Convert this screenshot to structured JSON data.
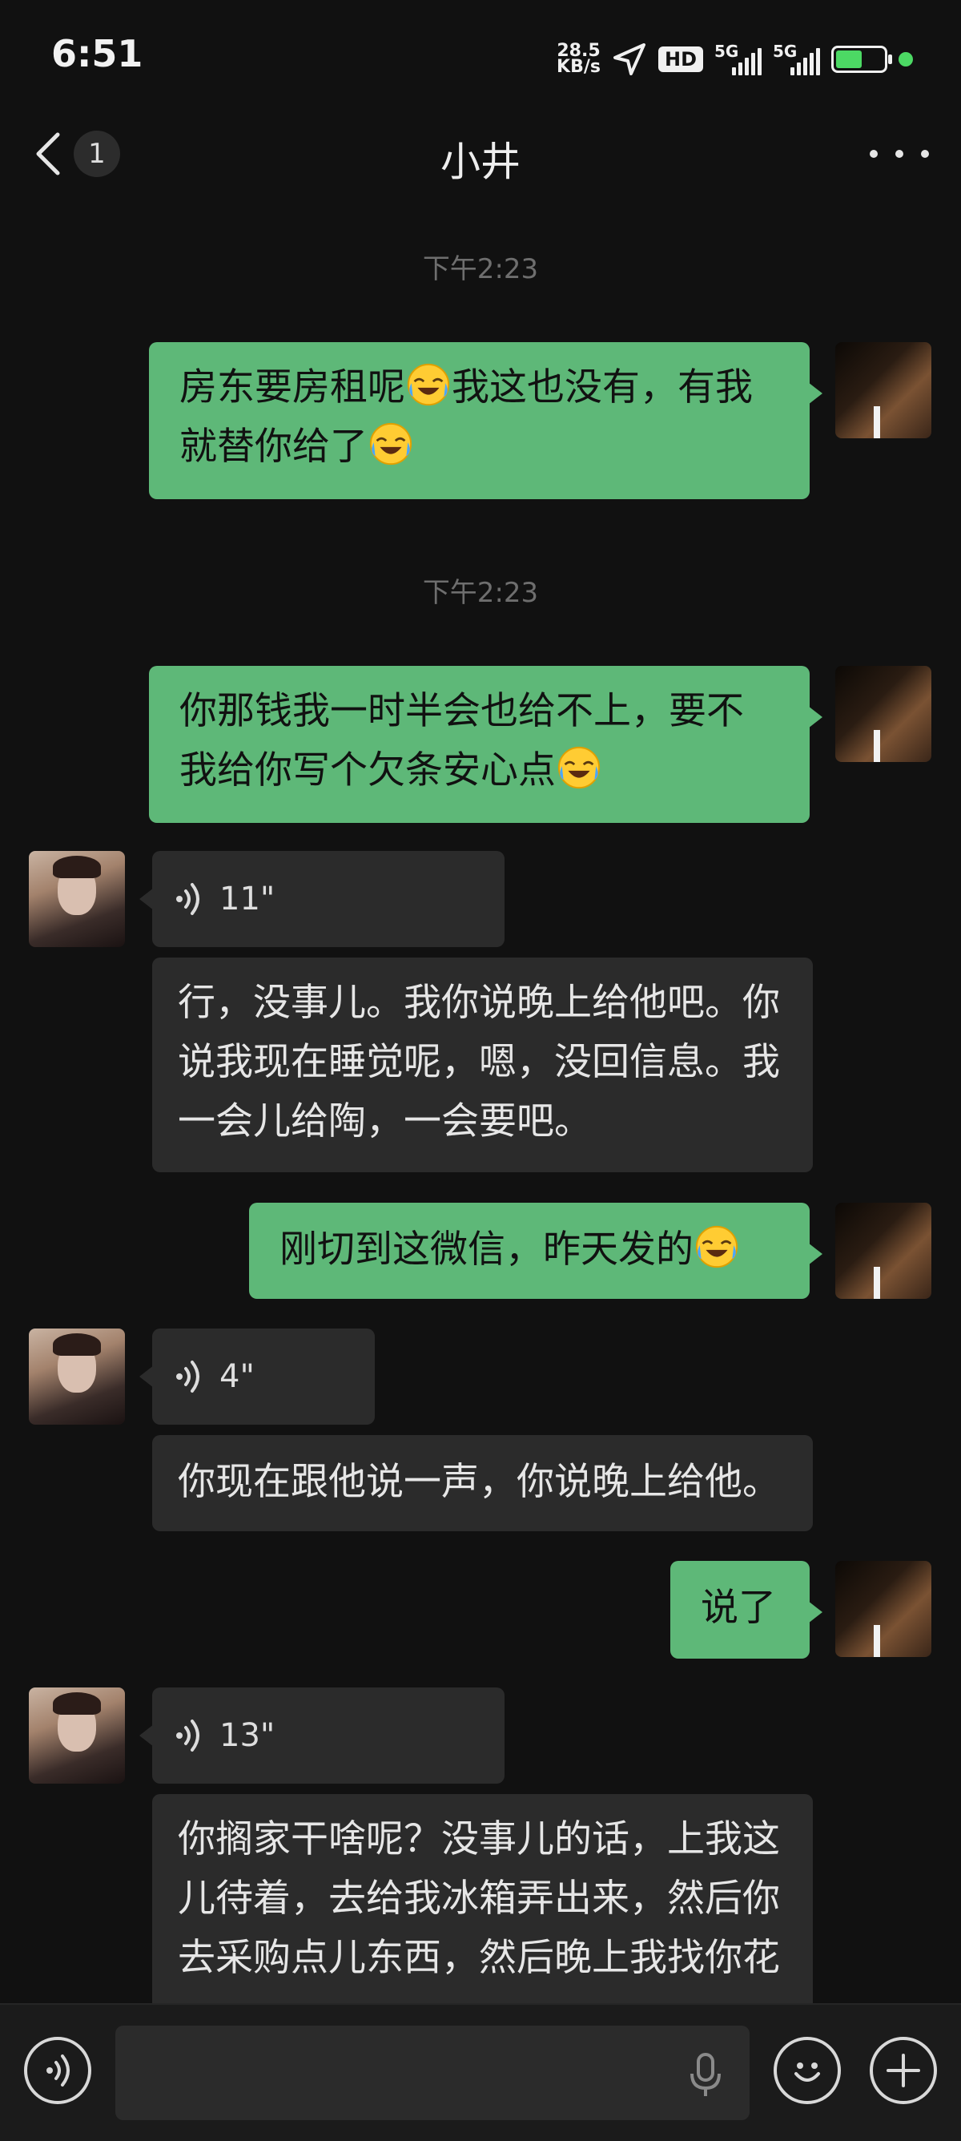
{
  "status": {
    "time": "6:51",
    "net_speed_value": "28.5",
    "net_speed_unit": "KB/s",
    "hd_label": "HD",
    "sim1_tag": "5G",
    "sim2_tag": "5G",
    "icons": [
      "location-arrow-icon",
      "hd-voice-icon",
      "signal-icon",
      "battery-charging-icon",
      "green-dot-icon"
    ]
  },
  "header": {
    "unread_count": "1",
    "title": "小井"
  },
  "messages": {
    "t1": "下午2:23",
    "m1": {
      "text_a": "房东要房租呢",
      "text_b": "我这也没有，有我就替你给了",
      "emoji": "laughing-tears-emoji"
    },
    "t2": "下午2:23",
    "m2": {
      "text": "你那钱我一时半会也给不上，要不我给你写个欠条安心点",
      "emoji": "laughing-tears-emoji"
    },
    "v1": {
      "duration": "11\""
    },
    "f1": {
      "text": "行，没事儿。我你说晚上给他吧。你说我现在睡觉呢，嗯，没回信息。我一会儿给陶，一会要吧。"
    },
    "m3": {
      "text": "刚切到这微信，昨天发的",
      "emoji": "laughing-tears-emoji"
    },
    "v2": {
      "duration": "4\""
    },
    "f2": {
      "text": "你现在跟他说一声，你说晚上给他。"
    },
    "m4": {
      "text": "说了"
    },
    "v3": {
      "duration": "13\""
    },
    "f3": {
      "text": "你搁家干啥呢？没事儿的话，上我这儿待着，去给我冰箱弄出来，然后你去采购点儿东西，然后晚上我找你花"
    }
  },
  "input": {
    "value": "",
    "placeholder": ""
  },
  "colors": {
    "my_bubble": "#5eb878",
    "friend_bubble": "#2b2b2b",
    "background": "#111111"
  }
}
